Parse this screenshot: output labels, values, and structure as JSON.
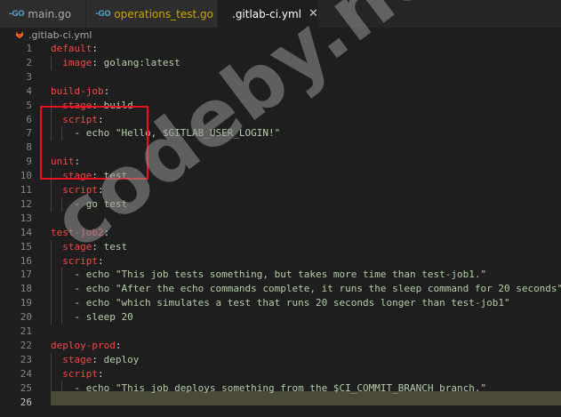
{
  "tabs": [
    {
      "label": "main.go",
      "icon": "go-file-icon"
    },
    {
      "label": "operations_test.go",
      "badge": "1",
      "icon": "go-file-icon"
    },
    {
      "label": ".gitlab-ci.yml",
      "icon": "gitlab-icon",
      "close": "✕",
      "active": true
    }
  ],
  "go_icon_text": "-GO",
  "breadcrumb": {
    "file": ".gitlab-ci.yml"
  },
  "watermark": "codeby.net",
  "colors": {
    "highlight": "#e81123",
    "key": "#f44747",
    "value": "#b5cea8"
  },
  "lines": [
    {
      "n": "1",
      "tokens": [
        [
          "k",
          "default"
        ],
        [
          "p",
          ":"
        ]
      ]
    },
    {
      "n": "2",
      "tokens": [
        [
          "p",
          "  "
        ],
        [
          "k",
          "image"
        ],
        [
          "p",
          ": "
        ],
        [
          "s",
          "golang:latest"
        ]
      ]
    },
    {
      "n": "3",
      "tokens": []
    },
    {
      "n": "4",
      "tokens": [
        [
          "k",
          "build-job"
        ],
        [
          "p",
          ":"
        ]
      ]
    },
    {
      "n": "5",
      "tokens": [
        [
          "p",
          "  "
        ],
        [
          "k",
          "stage"
        ],
        [
          "p",
          ": "
        ],
        [
          "s",
          "build"
        ]
      ]
    },
    {
      "n": "6",
      "tokens": [
        [
          "p",
          "  "
        ],
        [
          "k",
          "script"
        ],
        [
          "p",
          ":"
        ]
      ]
    },
    {
      "n": "7",
      "tokens": [
        [
          "p",
          "    "
        ],
        [
          "d",
          "- "
        ],
        [
          "s",
          "echo \"Hello, $GITLAB_USER_LOGIN!\""
        ]
      ]
    },
    {
      "n": "8",
      "tokens": []
    },
    {
      "n": "9",
      "tokens": [
        [
          "k",
          "unit"
        ],
        [
          "p",
          ":"
        ]
      ]
    },
    {
      "n": "10",
      "tokens": [
        [
          "p",
          "  "
        ],
        [
          "k",
          "stage"
        ],
        [
          "p",
          ": "
        ],
        [
          "s",
          "test"
        ]
      ]
    },
    {
      "n": "11",
      "tokens": [
        [
          "p",
          "  "
        ],
        [
          "k",
          "script"
        ],
        [
          "p",
          ":"
        ]
      ]
    },
    {
      "n": "12",
      "tokens": [
        [
          "p",
          "    "
        ],
        [
          "d",
          "- "
        ],
        [
          "s",
          "go test"
        ]
      ]
    },
    {
      "n": "13",
      "tokens": []
    },
    {
      "n": "14",
      "tokens": [
        [
          "k",
          "test-job2"
        ],
        [
          "p",
          ":"
        ]
      ]
    },
    {
      "n": "15",
      "tokens": [
        [
          "p",
          "  "
        ],
        [
          "k",
          "stage"
        ],
        [
          "p",
          ": "
        ],
        [
          "s",
          "test"
        ]
      ]
    },
    {
      "n": "16",
      "tokens": [
        [
          "p",
          "  "
        ],
        [
          "k",
          "script"
        ],
        [
          "p",
          ":"
        ]
      ]
    },
    {
      "n": "17",
      "tokens": [
        [
          "p",
          "    "
        ],
        [
          "d",
          "- "
        ],
        [
          "s",
          "echo \"This job tests something, but takes more time than test-job1.\""
        ]
      ]
    },
    {
      "n": "18",
      "tokens": [
        [
          "p",
          "    "
        ],
        [
          "d",
          "- "
        ],
        [
          "s",
          "echo \"After the echo commands complete, it runs the sleep command for 20 seconds\""
        ]
      ]
    },
    {
      "n": "19",
      "tokens": [
        [
          "p",
          "    "
        ],
        [
          "d",
          "- "
        ],
        [
          "s",
          "echo \"which simulates a test that runs 20 seconds longer than test-job1\""
        ]
      ]
    },
    {
      "n": "20",
      "tokens": [
        [
          "p",
          "    "
        ],
        [
          "d",
          "- "
        ],
        [
          "s",
          "sleep 20"
        ]
      ]
    },
    {
      "n": "21",
      "tokens": []
    },
    {
      "n": "22",
      "tokens": [
        [
          "k",
          "deploy-prod"
        ],
        [
          "p",
          ":"
        ]
      ]
    },
    {
      "n": "23",
      "tokens": [
        [
          "p",
          "  "
        ],
        [
          "k",
          "stage"
        ],
        [
          "p",
          ": "
        ],
        [
          "s",
          "deploy"
        ]
      ]
    },
    {
      "n": "24",
      "tokens": [
        [
          "p",
          "  "
        ],
        [
          "k",
          "script"
        ],
        [
          "p",
          ":"
        ]
      ]
    },
    {
      "n": "25",
      "tokens": [
        [
          "p",
          "    "
        ],
        [
          "d",
          "- "
        ],
        [
          "s",
          "echo \"This job deploys something from the $CI_COMMIT_BRANCH branch.\""
        ]
      ]
    },
    {
      "n": "26",
      "tokens": [],
      "active": true
    }
  ]
}
